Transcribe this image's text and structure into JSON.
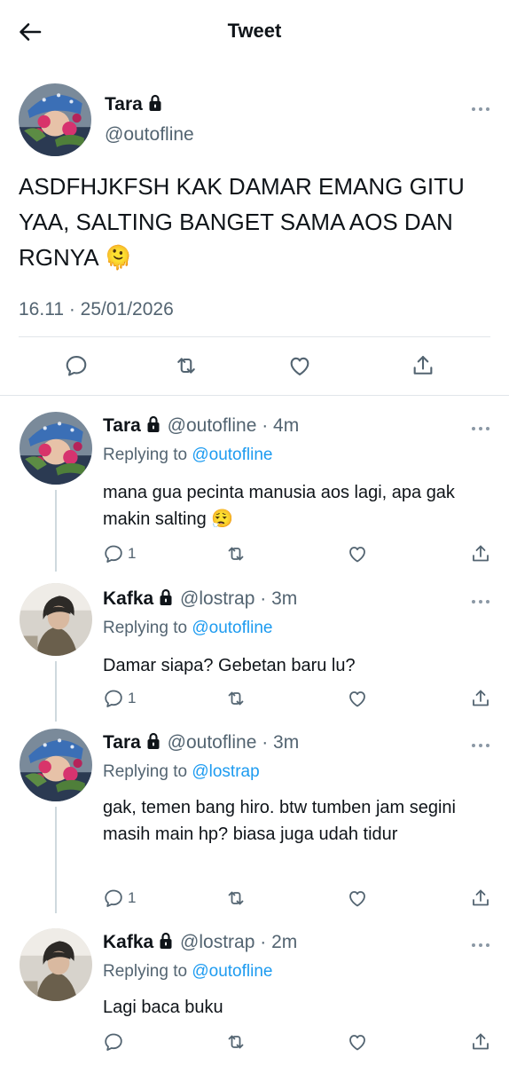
{
  "header": {
    "title": "Tweet"
  },
  "main_tweet": {
    "name": "Tara",
    "handle": "@outofline",
    "text": "ASDFHJKFSH KAK DAMAR EMANG GITU YAA, SALTING BANGET SAMA AOS DAN RGNYA 🫠",
    "timestamp": "16.11 · 25/01/2026"
  },
  "replies": [
    {
      "name": "Tara",
      "handle": "@outofline",
      "time": "· 4m",
      "replying_label": "Replying to",
      "replying_to": "@outofline",
      "text": "mana gua pecinta manusia aos lagi, apa gak makin salting 😮‍💨",
      "reply_count": "1"
    },
    {
      "name": "Kafka",
      "handle": "@lostrap",
      "time": "· 3m",
      "replying_label": "Replying to",
      "replying_to": "@outofline",
      "text": "Damar siapa? Gebetan baru lu?",
      "reply_count": "1"
    },
    {
      "name": "Tara",
      "handle": "@outofline",
      "time": "· 3m",
      "replying_label": "Replying to",
      "replying_to": "@lostrap",
      "text": "gak, temen bang hiro. btw tumben jam segini masih main hp? biasa juga udah tidur",
      "reply_count": "1"
    },
    {
      "name": "Kafka",
      "handle": "@lostrap",
      "time": "· 2m",
      "replying_label": "Replying to",
      "replying_to": "@outofline",
      "text": "Lagi baca buku",
      "reply_count": ""
    }
  ],
  "colors": {
    "accent": "#1d9bf0",
    "secondary_text": "#536471",
    "divider": "#e1e6ea"
  },
  "icons": [
    "back-arrow-icon",
    "lock-icon",
    "more-icon",
    "reply-icon",
    "retweet-icon",
    "like-icon",
    "share-icon"
  ]
}
